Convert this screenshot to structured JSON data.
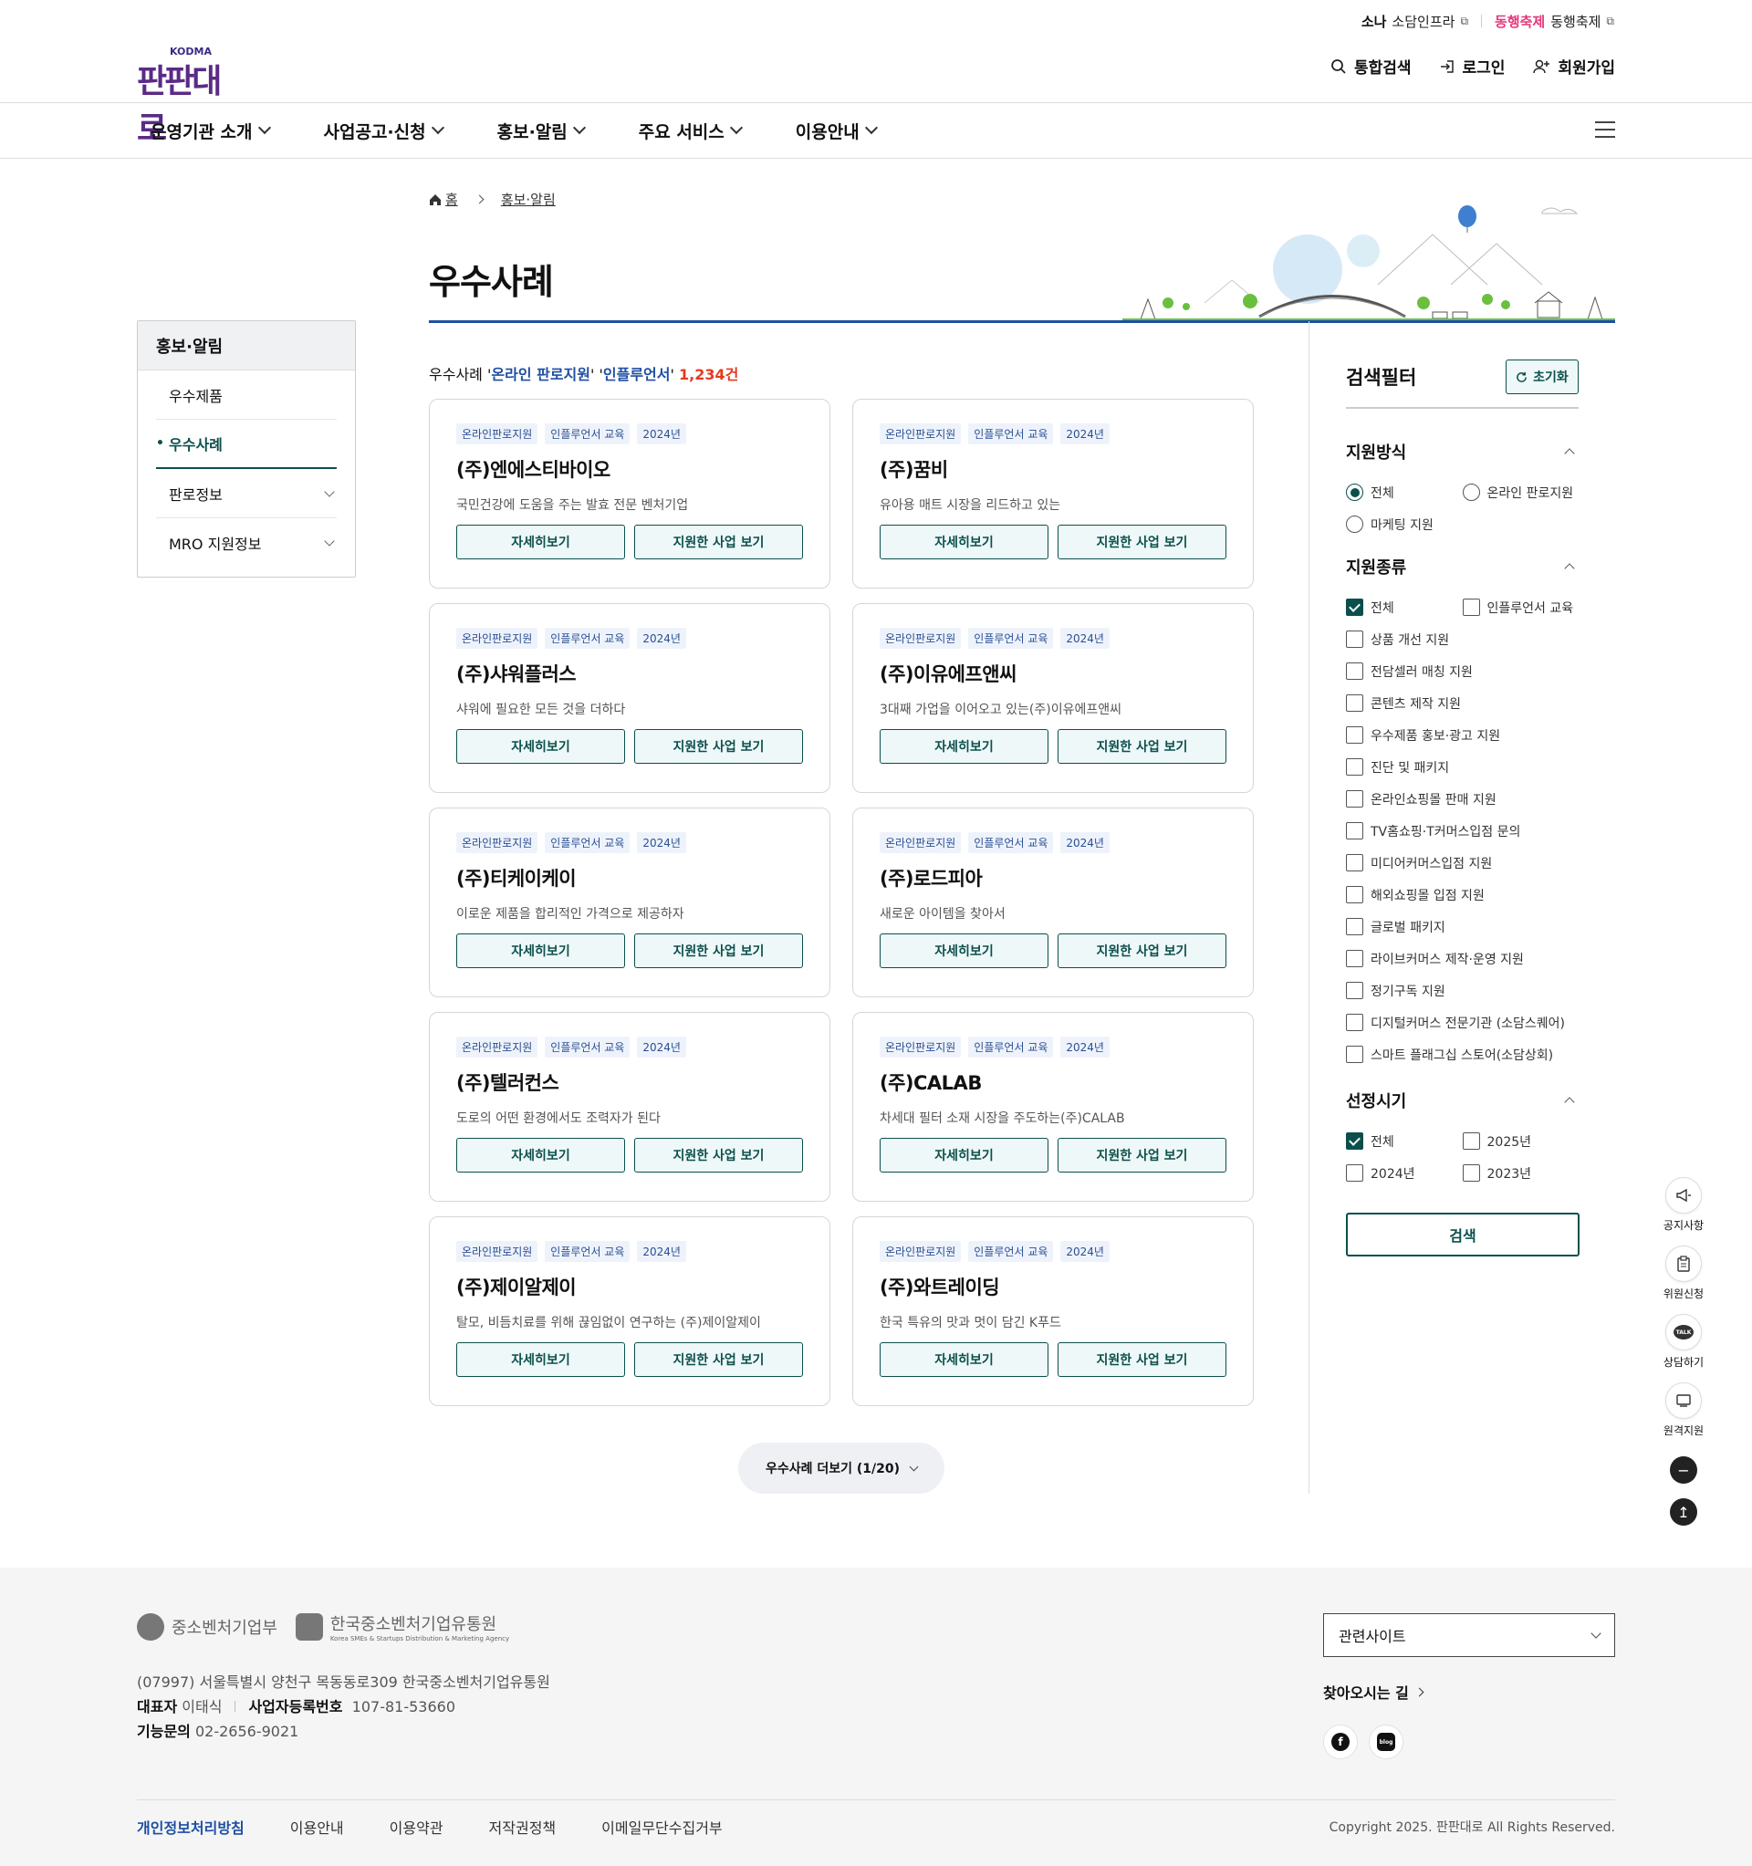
{
  "utility": {
    "sodam_logo": "소나",
    "sodam_label": "소담인프라",
    "festival_logo": "동행축제",
    "festival_label": "동행축제"
  },
  "header": {
    "logo_text": "판판대로",
    "logo_sub": "KODMA",
    "search_label": "통합검색",
    "login_label": "로그인",
    "signup_label": "회원가입"
  },
  "gnb": {
    "items": [
      {
        "label": "운영기관 소개"
      },
      {
        "label": "사업공고·신청"
      },
      {
        "label": "홍보·알림"
      },
      {
        "label": "주요 서비스"
      },
      {
        "label": "이용안내"
      }
    ]
  },
  "lnb": {
    "title": "홍보·알림",
    "items": [
      {
        "label": "우수제품"
      },
      {
        "label": "우수사례"
      },
      {
        "label": "판로정보"
      },
      {
        "label": "MRO 지원정보"
      }
    ]
  },
  "breadcrumb": {
    "home": "홈",
    "current": "홍보·알림"
  },
  "page": {
    "title": "우수사례"
  },
  "result": {
    "prefix": "우수사례 '",
    "keyword1": "온라인 판로지원",
    "mid": "' '",
    "keyword2": "인플루언서",
    "suffix": "' ",
    "count": "1,234건"
  },
  "cards": [
    {
      "tags": [
        "온라인판로지원",
        "인플루언서 교육",
        "2024년"
      ],
      "name": "(주)엔에스티바이오",
      "desc": "국민건강에 도움을 주는 발효 전문 벤처기업",
      "btn1": "자세히보기",
      "btn2": "지원한 사업 보기"
    },
    {
      "tags": [
        "온라인판로지원",
        "인플루언서 교육",
        "2024년"
      ],
      "name": "(주)꿈비",
      "desc": "유아용 매트 시장을 리드하고 있는",
      "btn1": "자세히보기",
      "btn2": "지원한 사업 보기"
    },
    {
      "tags": [
        "온라인판로지원",
        "인플루언서 교육",
        "2024년"
      ],
      "name": "(주)샤워플러스",
      "desc": "샤워에 필요한 모든 것을 더하다",
      "btn1": "자세히보기",
      "btn2": "지원한 사업 보기"
    },
    {
      "tags": [
        "온라인판로지원",
        "인플루언서 교육",
        "2024년"
      ],
      "name": "(주)이유에프앤씨",
      "desc": "3대째 가업을 이어오고 있는(주)이유에프앤씨",
      "btn1": "자세히보기",
      "btn2": "지원한 사업 보기"
    },
    {
      "tags": [
        "온라인판로지원",
        "인플루언서 교육",
        "2024년"
      ],
      "name": "(주)티케이케이",
      "desc": "이로운 제품을 합리적인 가격으로 제공하자",
      "btn1": "자세히보기",
      "btn2": "지원한 사업 보기"
    },
    {
      "tags": [
        "온라인판로지원",
        "인플루언서 교육",
        "2024년"
      ],
      "name": "(주)로드피아",
      "desc": "새로운 아이템을 찾아서",
      "btn1": "자세히보기",
      "btn2": "지원한 사업 보기"
    },
    {
      "tags": [
        "온라인판로지원",
        "인플루언서 교육",
        "2024년"
      ],
      "name": "(주)텔러컨스",
      "desc": "도로의 어떤 환경에서도 조력자가 된다",
      "btn1": "자세히보기",
      "btn2": "지원한 사업 보기"
    },
    {
      "tags": [
        "온라인판로지원",
        "인플루언서 교육",
        "2024년"
      ],
      "name": "(주)CALAB",
      "desc": "차세대 필터 소재 시장을 주도하는(주)CALAB",
      "btn1": "자세히보기",
      "btn2": "지원한 사업 보기"
    },
    {
      "tags": [
        "온라인판로지원",
        "인플루언서 교육",
        "2024년"
      ],
      "name": "(주)제이알제이",
      "desc": "탈모, 비듬치료를 위해 끊임없이 연구하는 (주)제이알제이",
      "btn1": "자세히보기",
      "btn2": "지원한 사업 보기"
    },
    {
      "tags": [
        "온라인판로지원",
        "인플루언서 교육",
        "2024년"
      ],
      "name": "(주)와트레이딩",
      "desc": "한국 특유의 맛과 멋이 담긴 K푸드",
      "btn1": "자세히보기",
      "btn2": "지원한 사업 보기"
    }
  ],
  "more": {
    "label": "우수사례 더보기 (1/20)"
  },
  "filter": {
    "title": "검색필터",
    "reset": "초기화",
    "method": {
      "title": "지원방식",
      "options": [
        {
          "label": "전체",
          "checked": true
        },
        {
          "label": "온라인 판로지원",
          "checked": false
        },
        {
          "label": "마케팅 지원",
          "checked": false
        }
      ]
    },
    "kind": {
      "title": "지원종류",
      "options": [
        {
          "label": "전체",
          "checked": true
        },
        {
          "label": "인플루언서 교육",
          "checked": false
        },
        {
          "label": "상품 개선 지원",
          "checked": false
        },
        {
          "label": "전담셀러 매칭 지원",
          "checked": false
        },
        {
          "label": "콘텐츠 제작 지원",
          "checked": false
        },
        {
          "label": "우수제품 홍보·광고 지원",
          "checked": false
        },
        {
          "label": "진단 및 패키지",
          "checked": false
        },
        {
          "label": "온라인쇼핑몰 판매 지원",
          "checked": false
        },
        {
          "label": "TV홈쇼핑·T커머스입점 문의",
          "checked": false
        },
        {
          "label": "미디어커머스입점 지원",
          "checked": false
        },
        {
          "label": "해외쇼핑몰 입점 지원",
          "checked": false
        },
        {
          "label": "글로벌 패키지",
          "checked": false
        },
        {
          "label": "라이브커머스 제작·운영 지원",
          "checked": false
        },
        {
          "label": "정기구독 지원",
          "checked": false
        },
        {
          "label": "디지털커머스 전문기관 (소담스퀘어)",
          "checked": false
        },
        {
          "label": "스마트 플래그십 스토어(소담상회)",
          "checked": false
        }
      ]
    },
    "period": {
      "title": "선정시기",
      "options": [
        {
          "label": "전체",
          "checked": true
        },
        {
          "label": "2025년",
          "checked": false
        },
        {
          "label": "2024년",
          "checked": false
        },
        {
          "label": "2023년",
          "checked": false
        }
      ]
    },
    "search": "검색"
  },
  "quick": {
    "notice": "공지사항",
    "apply": "위원신청",
    "consult": "상담하기",
    "remote": "원격지원",
    "talk_icon_text": "TALK"
  },
  "footer": {
    "logo1": "중소벤처기업부",
    "logo2": "한국중소벤처기업유통원",
    "logo2_sub": "Korea SMEs & Startups Distribution & Marketing Agency",
    "address": "(07997) 서울특별시 양천구 목동동로309 한국중소벤처기업유통원",
    "rep_label": "대표자",
    "rep_value": "이태식",
    "biz_label": "사업자등록번호",
    "biz_value": "107-81-53660",
    "contact_label": "기능문의",
    "contact_value": "02-2656-9021",
    "related_site": "관련사이트",
    "directions": "찾아오시는 길",
    "facebook": "f",
    "blog": "blog",
    "links": [
      "개인정보처리방침",
      "이용안내",
      "이용약관",
      "저작권정책",
      "이메일무단수집거부"
    ],
    "copyright": "Copyright 2025. 판판대로 All Rights Reserved."
  },
  "colors": {
    "primary": "#0b4f4c",
    "title_line": "#1f4fa3",
    "count": "#e53a1e",
    "tag_bg": "#eef3fb"
  }
}
